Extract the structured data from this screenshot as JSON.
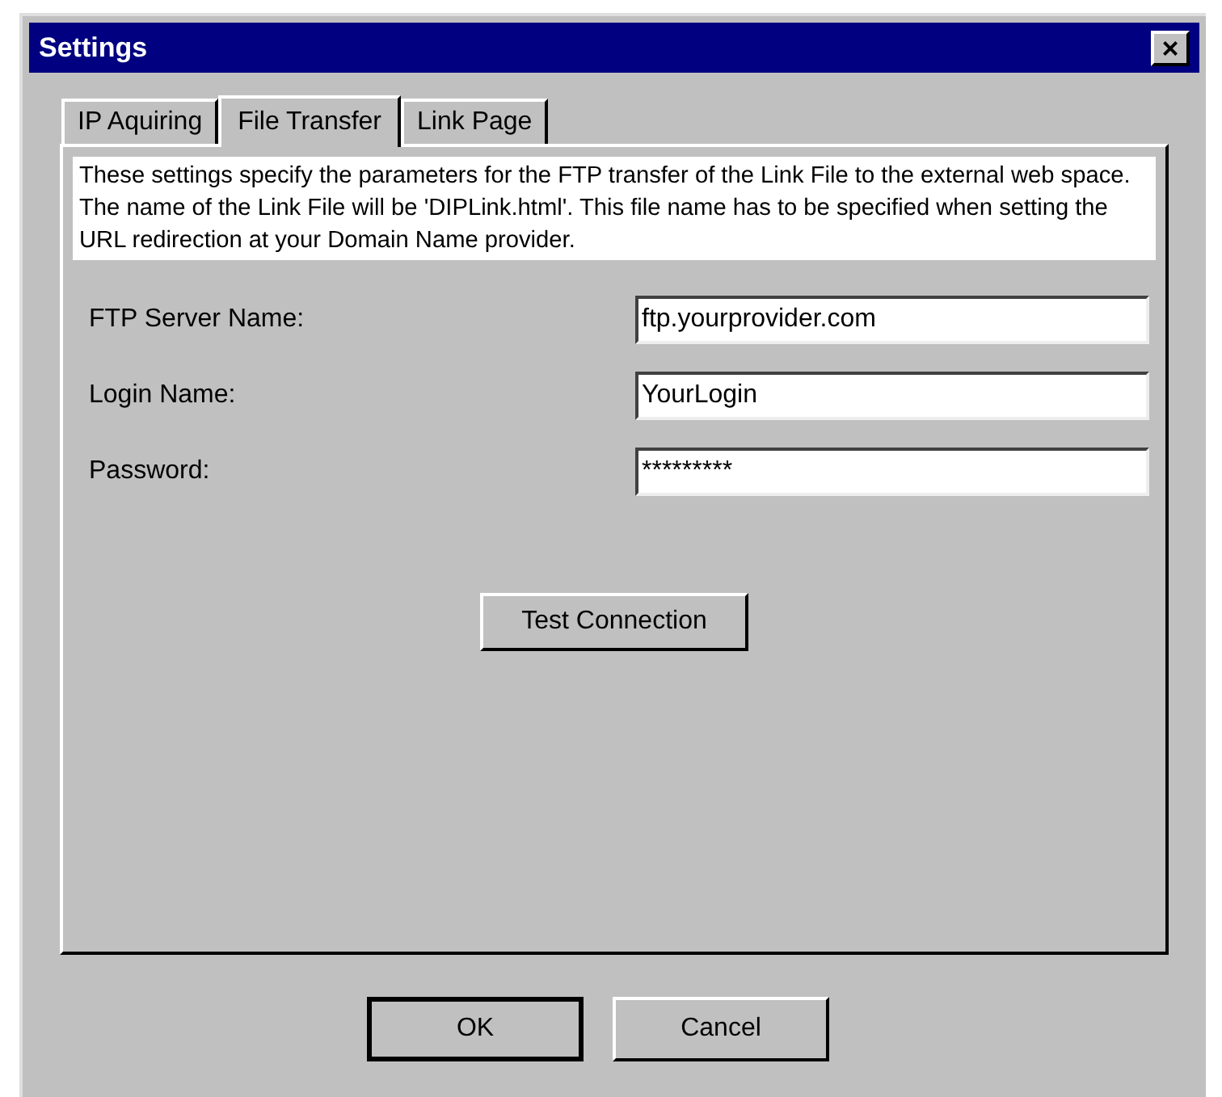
{
  "window": {
    "title": "Settings",
    "close": "×"
  },
  "tabs": [
    {
      "label": "IP Aquiring",
      "selected": false
    },
    {
      "label": "File Transfer",
      "selected": true
    },
    {
      "label": "Link Page",
      "selected": false
    }
  ],
  "description": [
    "These settings specify the parameters for the FTP transfer of the Link File to the external web space.",
    "The name of the Link File will be 'DIPLink.html'. This file name has to be specified when setting the URL redirection at your Domain Name provider."
  ],
  "fields": [
    {
      "label": "FTP Server Name:",
      "value": "ftp.yourprovider.com"
    },
    {
      "label": "Login Name:",
      "value": "YourLogin"
    },
    {
      "label": "Password:",
      "value": "*********"
    }
  ],
  "test_button": "Test Connection",
  "buttons": [
    {
      "label": "OK",
      "default": true
    },
    {
      "label": "Cancel",
      "default": false
    }
  ]
}
